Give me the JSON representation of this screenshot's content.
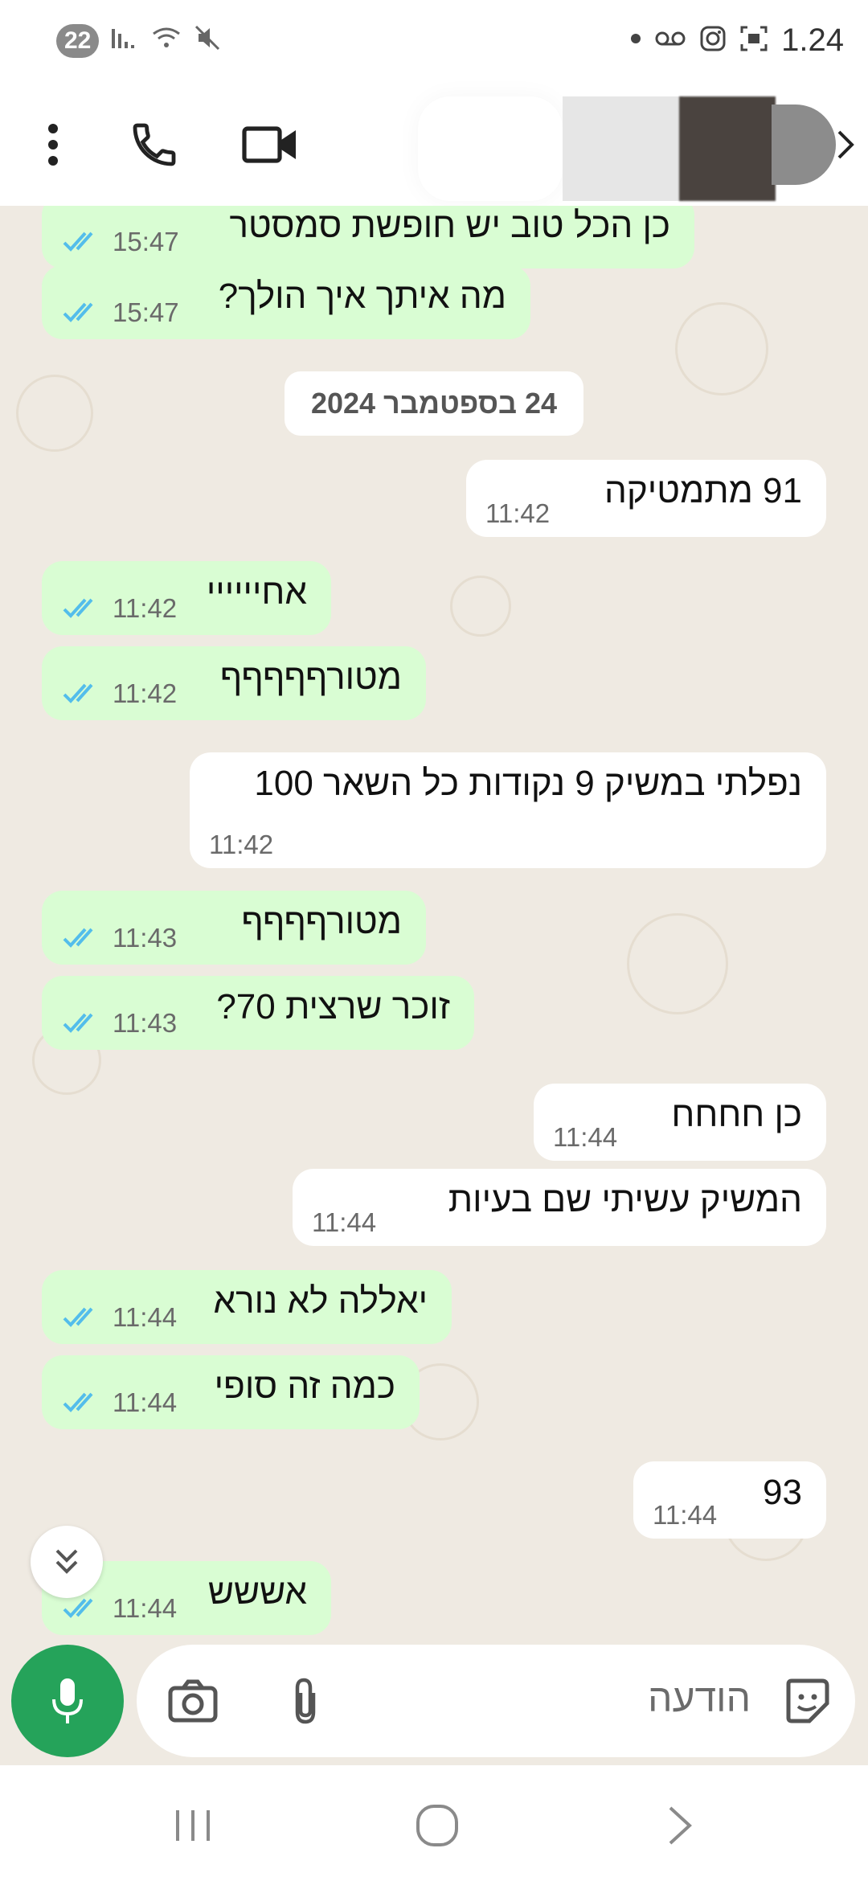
{
  "status_bar": {
    "time": "1‎.24",
    "notification_count": "22",
    "icons": [
      "signal-icon",
      "wifi-icon",
      "mute-icon",
      "dot-icon",
      "voicemail-icon",
      "instagram-icon",
      "screenshot-icon"
    ]
  },
  "header": {
    "contact_name": "",
    "actions": [
      "menu-icon",
      "phone-icon",
      "video-call-icon",
      "back-icon"
    ]
  },
  "chat": {
    "date_chip": "24 בספטמבר 2024",
    "messages": [
      {
        "dir": "out",
        "text": "כן הכל טוב יש חופשת סמסטר",
        "time": "15:47"
      },
      {
        "dir": "out",
        "text": "מה איתך איך הולך?",
        "time": "15:47"
      },
      {
        "dir": "in",
        "text": "91 מתמטיקה",
        "time": "11:42"
      },
      {
        "dir": "out",
        "text": "אחיייייי",
        "time": "11:42"
      },
      {
        "dir": "out",
        "text": "מטורףףףףף",
        "time": "11:42"
      },
      {
        "dir": "in",
        "text": "נפלתי במשיק 9 נקודות כל השאר 100",
        "time": "11:42"
      },
      {
        "dir": "out",
        "text": "מטורףףףף",
        "time": "11:43"
      },
      {
        "dir": "out",
        "text": "זוכר שרצית 70?",
        "time": "11:43"
      },
      {
        "dir": "in",
        "text": "כן חחחח",
        "time": "11:44"
      },
      {
        "dir": "in",
        "text": "המשיק עשיתי שם בעיות",
        "time": "11:44"
      },
      {
        "dir": "out",
        "text": "יאללה לא נורא",
        "time": "11:44"
      },
      {
        "dir": "out",
        "text": "כמה זה סופי",
        "time": "11:44"
      },
      {
        "dir": "in",
        "text": "93",
        "time": "11:44"
      },
      {
        "dir": "out",
        "text": "אששש",
        "time": "11:44"
      }
    ]
  },
  "composer": {
    "placeholder": "הודעה",
    "icons": [
      "sticker-icon",
      "attach-icon",
      "camera-icon",
      "mic-icon"
    ]
  },
  "nav": {
    "buttons": [
      "recents-icon",
      "home-icon",
      "back-icon"
    ]
  },
  "colors": {
    "outgoing": "#d9fdd3",
    "incoming": "#ffffff",
    "tick": "#53bdeb",
    "accent": "#25a35a",
    "background": "#efeae2"
  }
}
